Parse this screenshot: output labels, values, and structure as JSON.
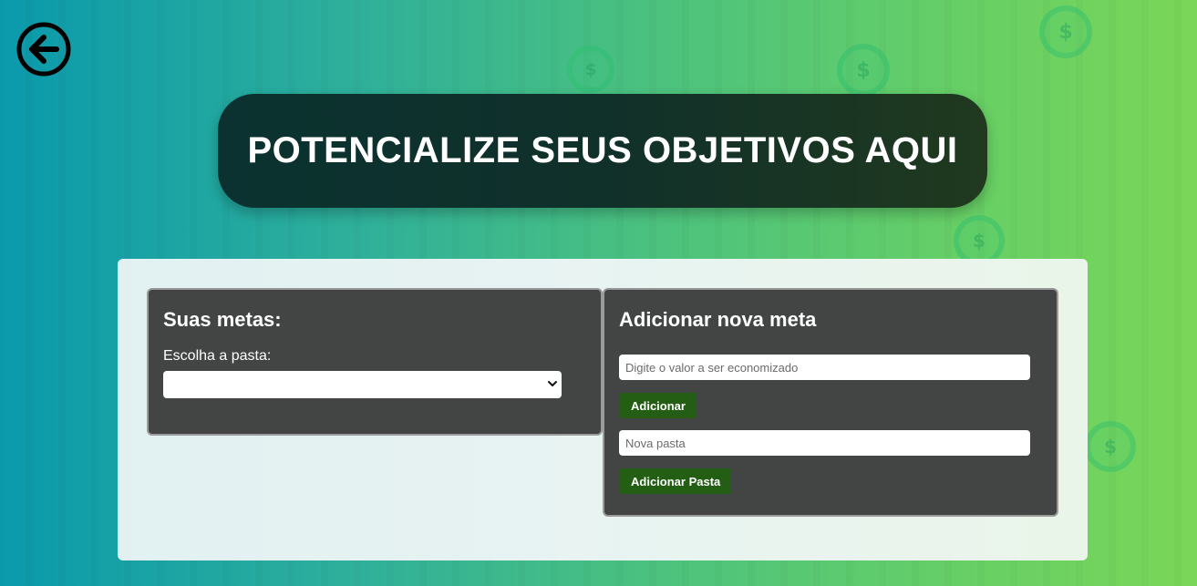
{
  "header": {
    "title": "POTENCIALIZE SEUS OBJETIVOS AQUI"
  },
  "nav": {
    "back_icon": "arrow-left-circle-icon"
  },
  "goals_panel": {
    "title": "Suas metas:",
    "folder_label": "Escolha a pasta:",
    "folder_selected": ""
  },
  "add_goal_panel": {
    "title": "Adicionar nova meta",
    "amount_placeholder": "Digite o valor a ser economizado",
    "add_button_label": "Adicionar",
    "folder_placeholder": "Nova pasta",
    "add_folder_button_label": "Adicionar Pasta"
  },
  "colors": {
    "hero_bg": "#0b3230",
    "panel_bg": "#434444",
    "button_bg": "#245e14"
  },
  "decor": {
    "background_icon": "dollar-coin-icon",
    "coin_symbol": "$"
  }
}
